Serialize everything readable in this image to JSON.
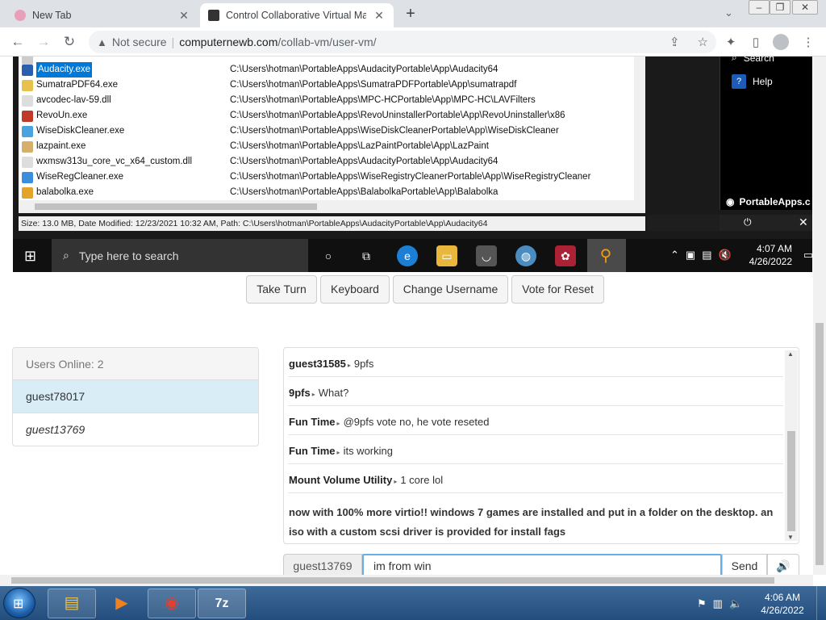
{
  "browser": {
    "tabs": [
      {
        "title": "New Tab",
        "active": false
      },
      {
        "title": "Control Collaborative Virtual Ma",
        "active": true
      }
    ],
    "address": {
      "security": "Not secure",
      "host": "computernewb.com",
      "path": "/collab-vm/user-vm/"
    }
  },
  "vm_screen": {
    "files": [
      {
        "name": "Audacity.exe",
        "path": "C:\\Users\\hotman\\PortableApps\\AudacityPortable\\App\\Audacity64",
        "selected": true,
        "icon": "headphones-icon",
        "color": "#2a5fb0"
      },
      {
        "name": "SumatraPDF64.exe",
        "path": "C:\\Users\\hotman\\PortableApps\\SumatraPDFPortable\\App\\sumatrapdf",
        "selected": false,
        "icon": "pdf-icon",
        "color": "#e6c24c"
      },
      {
        "name": "avcodec-lav-59.dll",
        "path": "C:\\Users\\hotman\\PortableApps\\MPC-HCPortable\\App\\MPC-HC\\LAVFilters",
        "selected": false,
        "icon": "file-icon",
        "color": "#dddddd"
      },
      {
        "name": "RevoUn.exe",
        "path": "C:\\Users\\hotman\\PortableApps\\RevoUninstallerPortable\\App\\RevoUninstaller\\x86",
        "selected": false,
        "icon": "revo-icon",
        "color": "#c0392b"
      },
      {
        "name": "WiseDiskCleaner.exe",
        "path": "C:\\Users\\hotman\\PortableApps\\WiseDiskCleanerPortable\\App\\WiseDiskCleaner",
        "selected": false,
        "icon": "wise-icon",
        "color": "#4aa3df"
      },
      {
        "name": "lazpaint.exe",
        "path": "C:\\Users\\hotman\\PortableApps\\LazPaintPortable\\App\\LazPaint",
        "selected": false,
        "icon": "paint-icon",
        "color": "#d4b06a"
      },
      {
        "name": "wxmsw313u_core_vc_x64_custom.dll",
        "path": "C:\\Users\\hotman\\PortableApps\\AudacityPortable\\App\\Audacity64",
        "selected": false,
        "icon": "file-icon",
        "color": "#dddddd"
      },
      {
        "name": "WiseRegCleaner.exe",
        "path": "C:\\Users\\hotman\\PortableApps\\WiseRegistryCleanerPortable\\App\\WiseRegistryCleaner",
        "selected": false,
        "icon": "wise-icon",
        "color": "#3b8ede"
      },
      {
        "name": "balabolka.exe",
        "path": "C:\\Users\\hotman\\PortableApps\\BalabolkaPortable\\App\\Balabolka",
        "selected": false,
        "icon": "balabolka-icon",
        "color": "#e2a42b"
      }
    ],
    "status_line": "Size: 13.0 MB, Date Modified: 12/23/2021 10:32 AM, Path: C:\\Users\\hotman\\PortableApps\\AudacityPortable\\App\\Audacity64",
    "portableapps_menu": {
      "search": "Search",
      "help": "Help",
      "brand": "PortableApps.c"
    },
    "taskbar": {
      "search_placeholder": "Type here to search",
      "time": "4:07 AM",
      "date": "4/26/2022"
    }
  },
  "controls": {
    "take_turn": "Take Turn",
    "keyboard": "Keyboard",
    "change_username": "Change Username",
    "vote_reset": "Vote for Reset"
  },
  "users": {
    "header": "Users Online: 2",
    "list": [
      "guest78017",
      "guest13769"
    ]
  },
  "chat": {
    "messages": [
      {
        "user": "guest31585",
        "text": "9pfs"
      },
      {
        "user": "9pfs",
        "text": "What?"
      },
      {
        "user": "Fun Time",
        "text": "@9pfs vote no, he vote reseted"
      },
      {
        "user": "Fun Time",
        "text": "its working"
      },
      {
        "user": "Mount Volume Utility",
        "text": "1 core lol"
      }
    ],
    "system_message": "now with 100% more virtio!! windows 7 games are installed and put in a folder on the desktop. an iso with a custom scsi driver is provided for install fags",
    "username": "guest13769",
    "input_value": "im from win",
    "send_label": "Send"
  },
  "host_taskbar": {
    "time": "4:06 AM",
    "date": "4/26/2022"
  }
}
